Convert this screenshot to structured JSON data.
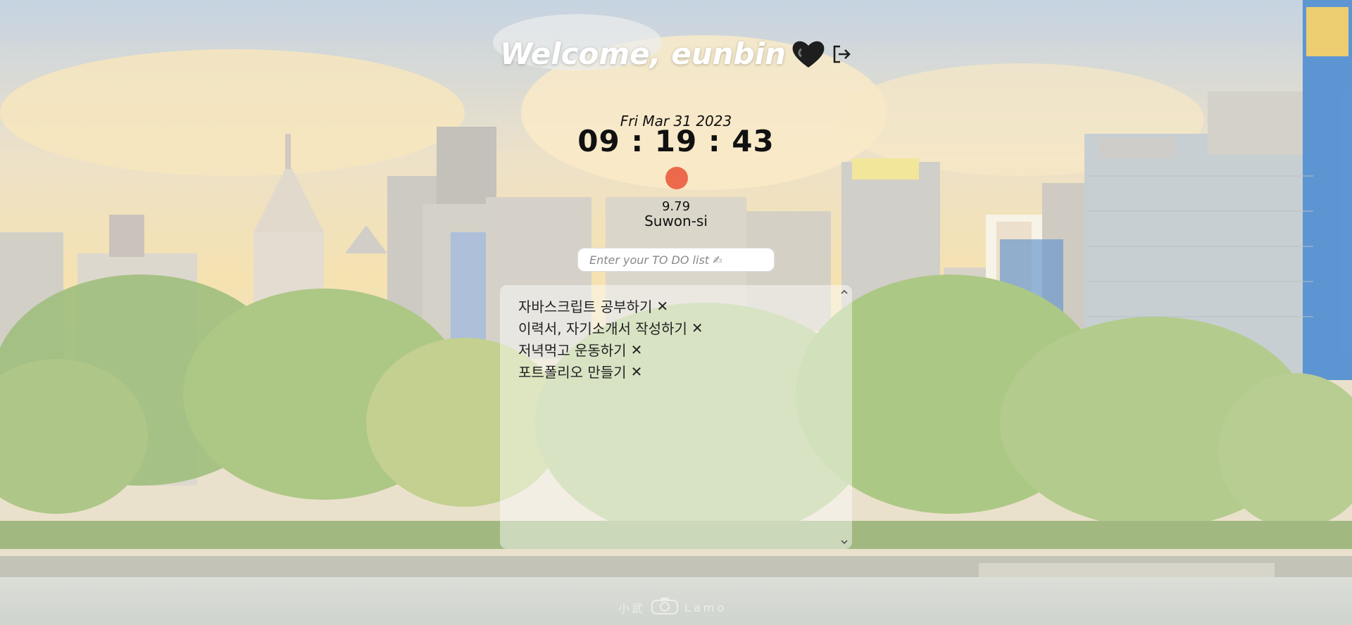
{
  "header": {
    "welcome": "Welcome, eunbin"
  },
  "clock": {
    "date": "Fri Mar 31 2023",
    "time": "09 : 19 : 43"
  },
  "weather": {
    "temperature": "9.79",
    "city": "Suwon-si",
    "icon": "weather-sun-icon",
    "icon_color": "#ec6a4b"
  },
  "todo": {
    "placeholder": "Enter your TO DO list ✍",
    "items": [
      {
        "text": "자바스크립트 공부하기",
        "delete_label": "✕"
      },
      {
        "text": "이력서, 자기소개서 작성하기",
        "delete_label": "✕"
      },
      {
        "text": "저녁먹고 운동하기",
        "delete_label": "✕"
      },
      {
        "text": "포트폴리오 만들기",
        "delete_label": "✕"
      }
    ]
  },
  "icons": {
    "heart": "heart-icon",
    "logout": "logout-icon",
    "camera": "camera-icon"
  },
  "watermark": {
    "left": "小武",
    "right": "Lamo"
  }
}
